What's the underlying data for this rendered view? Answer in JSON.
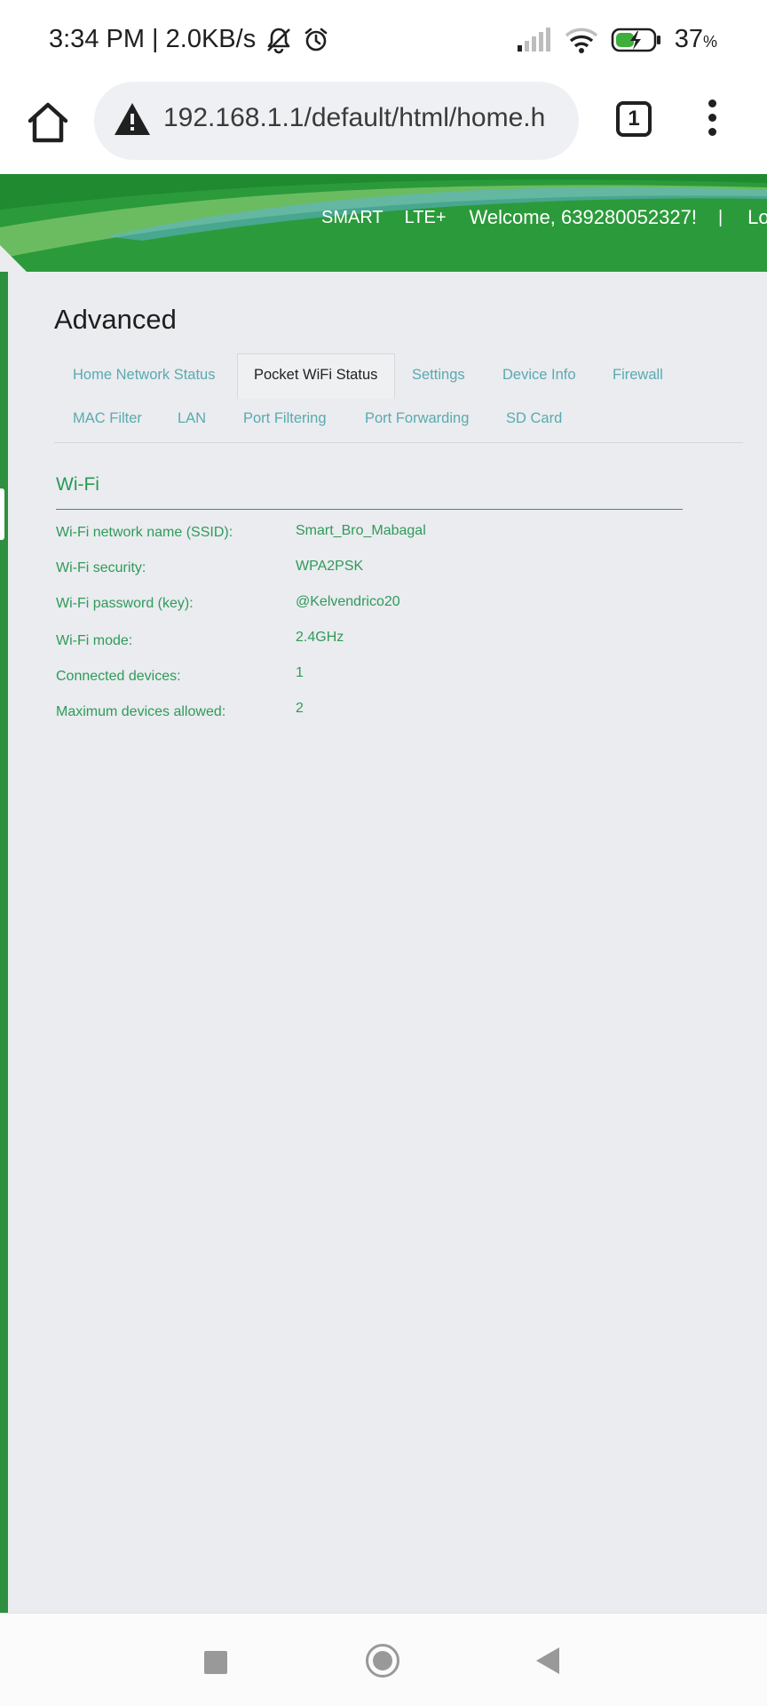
{
  "status_bar": {
    "time_speed": "3:34 PM | 2.0KB/s",
    "battery_percent": "37",
    "battery_unit": "%",
    "icons": [
      "bell-muted-icon",
      "alarm-icon",
      "signal-icon",
      "wifi-icon",
      "battery-charging-icon"
    ]
  },
  "browser": {
    "url": "192.168.1.1/default/html/home.h",
    "tab_count": "1",
    "icons": [
      "home-icon",
      "warning-icon",
      "tabs-icon",
      "more-vert-icon"
    ]
  },
  "header": {
    "brand": "SMART",
    "network": "LTE+",
    "welcome": "Welcome, 639280052327!",
    "separator": "|",
    "logout": "Logou"
  },
  "page": {
    "title": "Advanced",
    "tabs_row1": [
      "Home Network Status",
      "Pocket WiFi Status",
      "Settings",
      "Device Info",
      "Firewall"
    ],
    "tabs_row2": [
      "MAC Filter",
      "LAN",
      "Port Filtering",
      "Port Forwarding",
      "SD Card"
    ],
    "active_tab": "Pocket WiFi Status"
  },
  "wifi": {
    "section_title": "Wi-Fi",
    "rows": [
      {
        "label": "Wi-Fi network name (SSID):",
        "value": "Smart_Bro_Mabagal"
      },
      {
        "label": "Wi-Fi security:",
        "value": "WPA2PSK"
      },
      {
        "label": "Wi-Fi password (key):",
        "value": "@Kelvendrico20"
      },
      {
        "label": "Wi-Fi mode:",
        "value": "2.4GHz"
      },
      {
        "label": "Connected devices:",
        "value": "1"
      },
      {
        "label": "Maximum devices allowed:",
        "value": "2"
      }
    ]
  },
  "colors": {
    "brand_green": "#2b9a3b",
    "text_green": "#2f9a5a",
    "tab_teal": "#5aaab0",
    "content_bg": "#eaecef"
  }
}
